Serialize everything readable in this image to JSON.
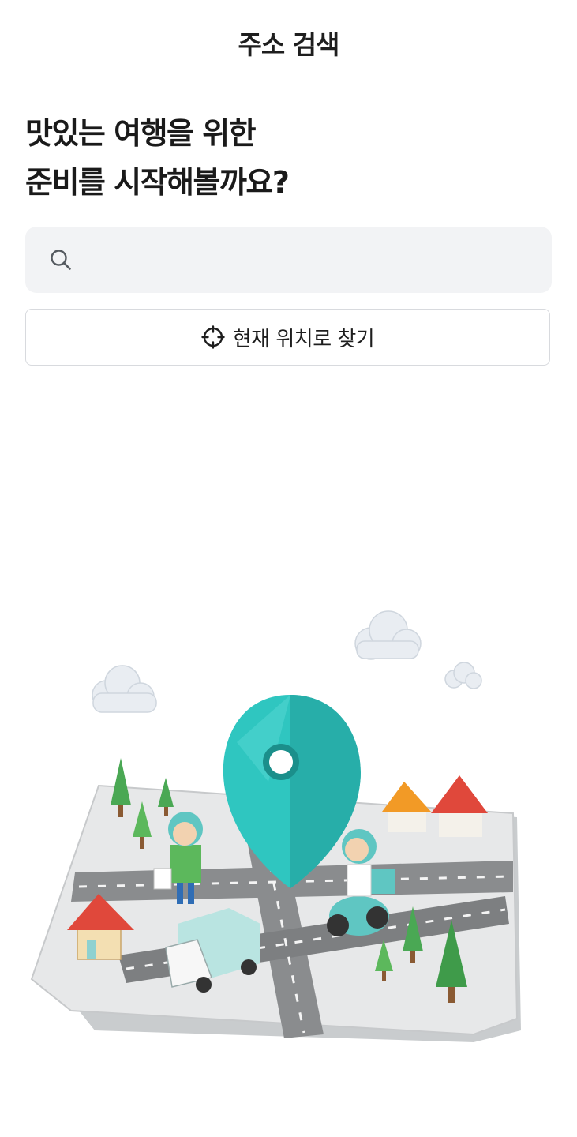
{
  "header": {
    "title": "주소 검색"
  },
  "headline": {
    "line1": "맛있는 여행을 위한",
    "line2": "준비를 시작해볼까요?"
  },
  "search": {
    "value": "",
    "placeholder": "",
    "icon": "search-icon"
  },
  "location_button": {
    "label": "현재 위치로 찾기",
    "icon": "crosshair-icon"
  },
  "illustration": {
    "name": "isometric-town-map-with-location-pin",
    "accent": "#2fc6c0"
  }
}
